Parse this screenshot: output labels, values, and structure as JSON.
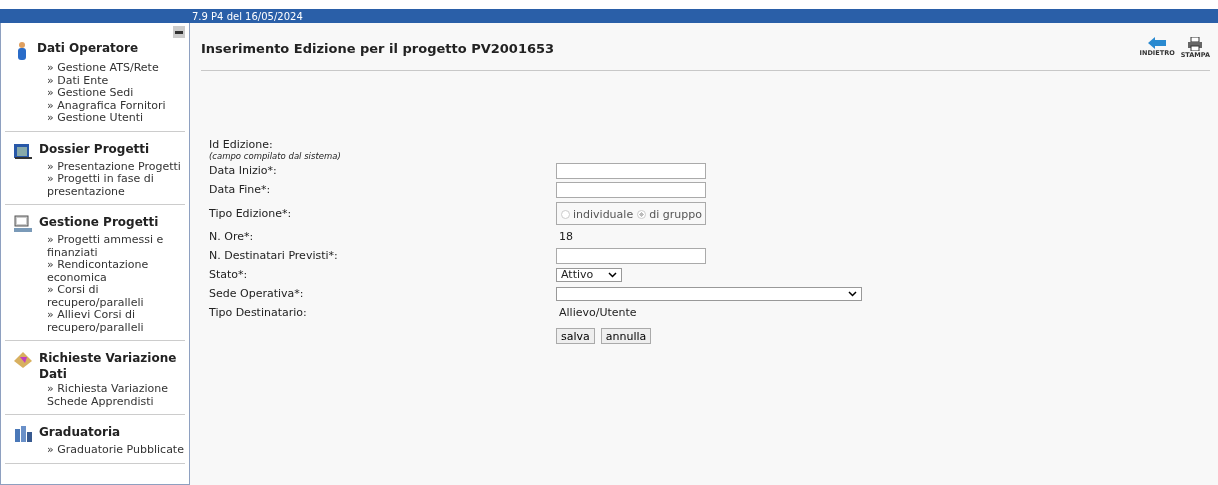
{
  "version_bar": {
    "text": "7.9 P4 del 16/05/2024"
  },
  "sidebar": {
    "sections": [
      {
        "kind": "person",
        "title": "Dati Operatore",
        "items": [
          "» Gestione ATS/Rete",
          "» Dati Ente",
          "» Gestione Sedi",
          "» Anagrafica Fornitori",
          "» Gestione Utenti"
        ]
      },
      {
        "kind": "folder",
        "title": "Dossier Progetti",
        "items": [
          "» Presentazione Progetti",
          "» Progetti in fase di presentazione"
        ]
      },
      {
        "kind": "computer",
        "title": "Gestione Progetti",
        "items": [
          "» Progetti ammessi e finanziati",
          "» Rendicontazione economica",
          "» Corsi di recupero/paralleli",
          "» Allievi Corsi di recupero/paralleli"
        ]
      },
      {
        "kind": "pencil",
        "title": "Richieste Variazione Dati",
        "items": [
          "» Richiesta Variazione Schede Apprendisti"
        ]
      },
      {
        "kind": "chart",
        "title": "Graduatoria",
        "items": [
          "» Graduatorie Pubblicate"
        ]
      }
    ]
  },
  "page": {
    "title": "Inserimento Edizione per il progetto PV2001653",
    "toolbar": [
      {
        "kind": "back",
        "label": "INDIETRO"
      },
      {
        "kind": "print",
        "label": "STAMPA"
      }
    ]
  },
  "form": {
    "rows": [
      {
        "label": "Id Edizione:",
        "note": "(campo compilato dal sistema)",
        "kind": "none"
      },
      {
        "label": "Data Inizio*:",
        "kind": "input"
      },
      {
        "label": "Data Fine*:",
        "kind": "input"
      },
      {
        "label": "Tipo Edizione*:",
        "kind": "radio",
        "options": [
          {
            "label": "individuale",
            "selected": false,
            "disabled": true
          },
          {
            "label": "di gruppo",
            "selected": true,
            "disabled": true
          }
        ]
      },
      {
        "label": "N. Ore*:",
        "kind": "text",
        "value": "18"
      },
      {
        "label": "N. Destinatari Previsti*:",
        "kind": "input"
      },
      {
        "label": "Stato*:",
        "kind": "select",
        "value": "Attivo"
      },
      {
        "label": "Sede Operativa*:",
        "kind": "wide-select"
      },
      {
        "label": "Tipo Destinatario:",
        "kind": "text",
        "value": "Allievo/Utente"
      }
    ],
    "buttons": [
      "salva",
      "annulla"
    ]
  }
}
